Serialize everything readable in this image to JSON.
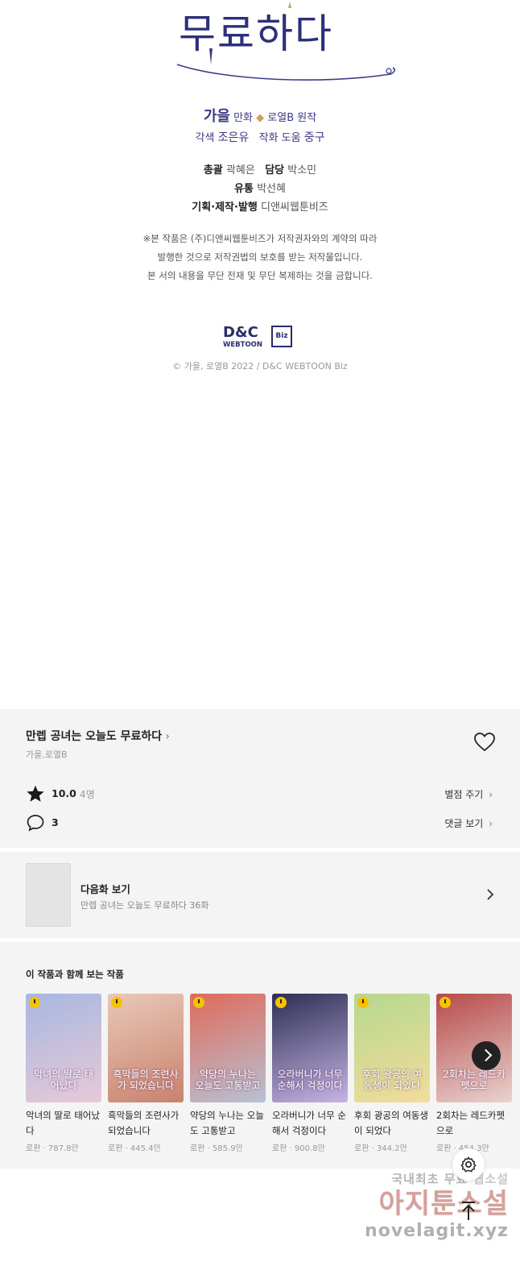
{
  "credits": {
    "title_glyph": "무료하다",
    "line1": {
      "artist_name": "가을",
      "artist_role": "만화",
      "author_name": "로열B",
      "author_role": "원작"
    },
    "line2": {
      "adapt_role": "각색",
      "adapt_name": "조은유",
      "assist_role": "작화 도움",
      "assist_name": "중구"
    },
    "staff": [
      {
        "role": "총괄",
        "name": "곽혜은",
        "role2": "담당",
        "name2": "박소민"
      },
      {
        "role": "유통",
        "name": "박선혜"
      },
      {
        "role": "기획·제작·발행",
        "name": "디앤씨웹툰비즈"
      }
    ],
    "notice": [
      "※본 작품은 (주)디앤씨웹툰비즈가 저작권자와의 계약의 따라",
      "발행한 것으로 저작권법의 보호를 받는 저작물입니다.",
      "본 서의 내용을 무단 전재 및 무단 복제하는 것을 금합니다."
    ],
    "publisher_logo_top": "D&C",
    "publisher_logo_bottom": "WEBTOON",
    "publisher_logo_badge": "Biz",
    "copyright": "© 가을, 로열B 2022 / D&C WEBTOON Biz"
  },
  "series": {
    "title": "만렙 공녀는 오늘도 무료하다",
    "authors": "가을,로열B",
    "rating": "10.0",
    "rating_count": "4명",
    "rate_label": "별점 주기",
    "comment_count": "3",
    "comment_label": "댓글 보기"
  },
  "next_episode": {
    "label": "다음화 보기",
    "subtitle": "만렙 공녀는 오늘도 무료하다 36화"
  },
  "recommendations": {
    "title": "이 작품과 함께 보는 작품",
    "items": [
      {
        "name": "악녀의 딸로 태어났다",
        "meta": "로판 · 787.8만",
        "cover_text": "악녀의 딸로 태어났다",
        "color_a": "#a7b7e0",
        "color_b": "#e8c9d8"
      },
      {
        "name": "흑막들의 조련사가 되었습니다",
        "meta": "로판 · 445.4만",
        "cover_text": "흑막들의 조련사가 되었습니다",
        "color_a": "#e9c8b8",
        "color_b": "#c9826e"
      },
      {
        "name": "약당의 누나는 오늘도 고통받고",
        "meta": "로판 · 585.9만",
        "cover_text": "약당의 누나는 오늘도 고통받고",
        "color_a": "#e06a5a",
        "color_b": "#b8c2d4"
      },
      {
        "name": "오라버니가 너무 순해서 걱정이다",
        "meta": "로판 · 900.8만",
        "cover_text": "오라버니가 너무 순해서 걱정이다",
        "color_a": "#2c2f52",
        "color_b": "#c6b4e6"
      },
      {
        "name": "후회 광공의 여동생이 되었다",
        "meta": "로판 · 344.2만",
        "cover_text": "후회 광공의 여동생이 되었다",
        "color_a": "#b5d88e",
        "color_b": "#f3dc9c"
      },
      {
        "name": "2회차는 레드카펫으로",
        "meta": "로판 · 454.3만",
        "cover_text": "2회차는 레드카펫으로",
        "color_a": "#b74b4b",
        "color_b": "#e9d3cf"
      }
    ]
  },
  "watermark": {
    "line1_a": "국내최초 무료",
    "line1_b": "웹소설",
    "line2": "아지툰소설",
    "line3": "novelagit.xyz"
  },
  "colors": {
    "brand_purple": "#3d3a86",
    "panel_bg": "#f4f4f4",
    "badge_yellow": "#f6c300"
  }
}
